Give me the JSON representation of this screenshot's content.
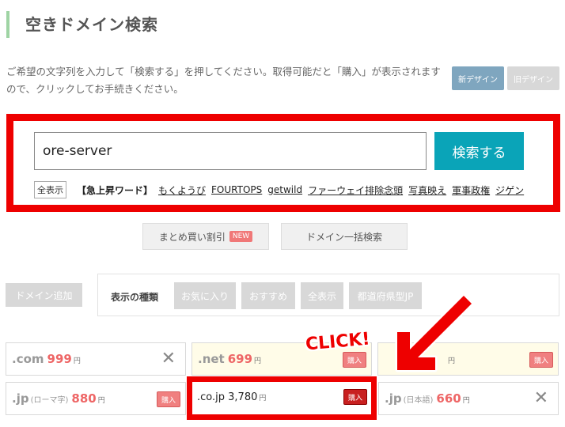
{
  "page": {
    "title": "空きドメイン検索",
    "description": "ご希望の文字列を入力して「検索する」を押してください。取得可能だと「購入」が表示されますので、クリックしてお手続きください。"
  },
  "design_toggle": {
    "new_label": "新デザイン",
    "old_label": "旧デザイン"
  },
  "search": {
    "input_value": "ore-server",
    "button_label": "検索する"
  },
  "trending": {
    "show_all_label": "全表示",
    "label": "【急上昇ワード】",
    "words": [
      "もくようび",
      "FOURTOPS",
      "getwild",
      "ファーウェイ排除念頭",
      "写真映え",
      "軍事政権",
      "ジゲン"
    ]
  },
  "sub_buttons": {
    "bulk_discount_label": "まとめ買い割引",
    "new_badge": "NEW",
    "bulk_search_label": "ドメイン一括検索"
  },
  "domain_add_label": "ドメイン追加",
  "filter": {
    "label": "表示の種類",
    "chips": [
      "お気に入り",
      "おすすめ",
      "全表示",
      "都道府県型JP"
    ]
  },
  "results": [
    {
      "tld": ".com",
      "note": "",
      "price": "999",
      "unit": "円",
      "action": "close"
    },
    {
      "tld": ".net",
      "note": "",
      "price": "699",
      "unit": "円",
      "action": "buy"
    },
    {
      "tld": ".jp",
      "note": "(ローマ字)",
      "price": "880",
      "unit": "円",
      "action": "buy"
    },
    {
      "tld": ".jp",
      "note": "(日本語)",
      "price": "660",
      "unit": "円",
      "action": "close"
    }
  ],
  "highlight": {
    "tld": ".co.jp",
    "price": "3,780",
    "unit": "円",
    "buy_label": "購入"
  },
  "third_card_buy_label": "購入",
  "third_card_unit": "円",
  "buy_label": "購入",
  "annotation": {
    "click_text": "CLICK!"
  },
  "colors": {
    "accent": "#0aa4b8",
    "highlight_red": "#ee0000",
    "price_red": "#ee6666"
  }
}
